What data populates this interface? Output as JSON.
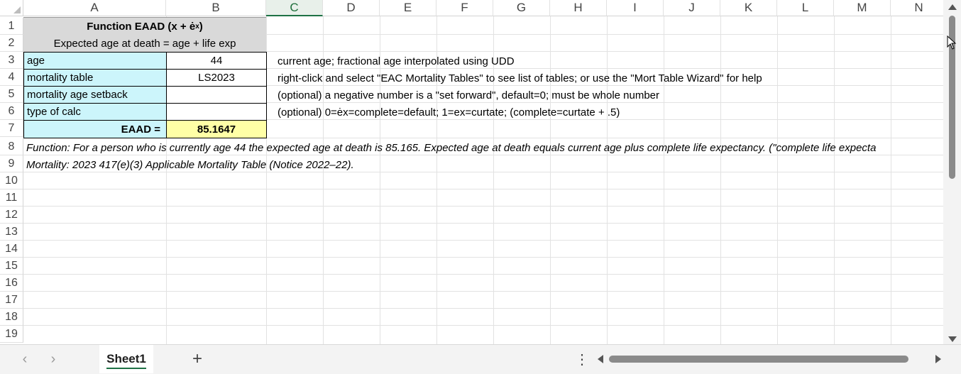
{
  "columns": [
    "A",
    "B",
    "C",
    "D",
    "E",
    "F",
    "G",
    "H",
    "I",
    "J",
    "K",
    "L",
    "M",
    "N"
  ],
  "rows": [
    "1",
    "2",
    "3",
    "4",
    "5",
    "6",
    "7",
    "8",
    "9",
    "10",
    "11",
    "12",
    "13",
    "14",
    "15",
    "16",
    "17",
    "18",
    "19"
  ],
  "cells": {
    "title": "Function EAAD (x + ė",
    "title_sub": "x",
    "title_close": ")",
    "subtitle": "Expected age at death = age + life exp",
    "a3": "age",
    "b3": "44",
    "a4": "mortality table",
    "b4": "LS2023",
    "a5": "mortality age setback",
    "b5": "",
    "a6": "type of calc",
    "b6": "",
    "a7": "EAAD =",
    "b7": "85.1647",
    "c3": "current age; fractional age interpolated using UDD",
    "c4": "right-click and select \"EAC Mortality Tables\" to see list of tables; or use the \"Mort Table Wizard\" for help",
    "c5": "(optional) a negative number is a \"set forward\", default=0; must be whole number",
    "c6": "(optional) 0=ėx=complete=default; 1=ex=curtate; (complete=curtate + .5)",
    "a8": "Function: For a person who is currently age 44 the expected age at death is 85.165. Expected age at death equals current age plus complete life expectancy. (\"complete life expecta",
    "a9": "Mortality:  2023 417(e)(3) Applicable Mortality Table (Notice 2022–22)."
  },
  "sheet_tabs": [
    {
      "label": "Sheet1",
      "active": true
    }
  ],
  "bottom_bar": {
    "prev": "‹",
    "next": "›",
    "add": "+",
    "more": "⋮"
  },
  "colors": {
    "header_gray": "#d9d9d9",
    "input_cyan": "#ccf5fb",
    "result_yellow": "#ffffa6",
    "accent_green": "#1e7145"
  }
}
